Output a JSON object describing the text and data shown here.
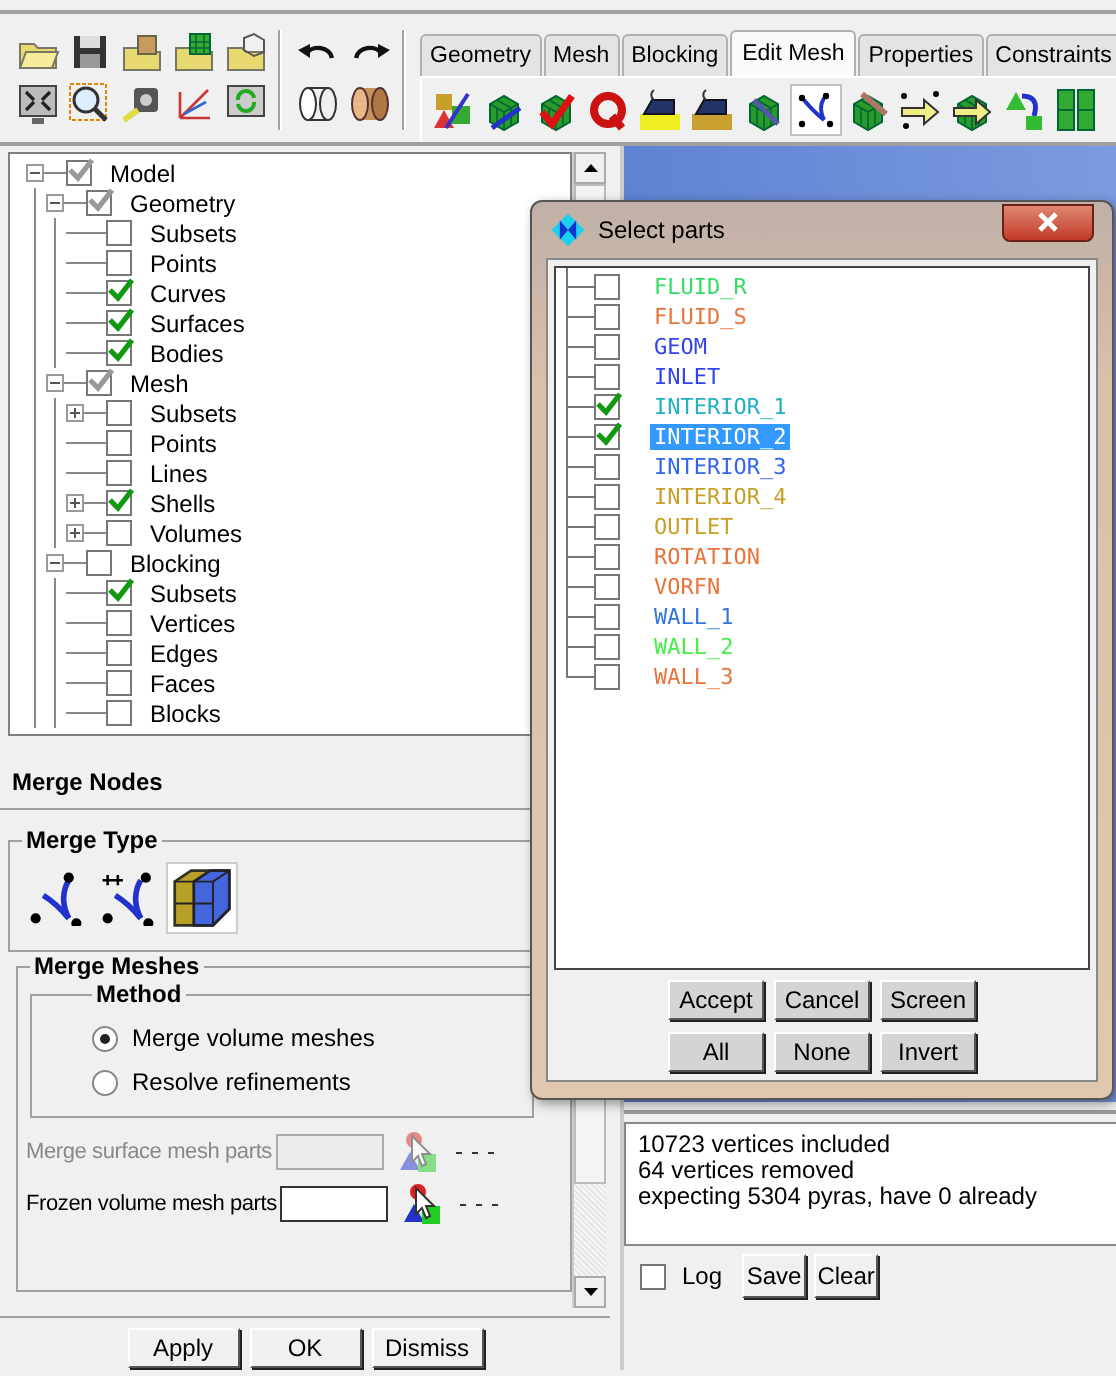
{
  "tabs": [
    {
      "label": "Geometry",
      "selected": false
    },
    {
      "label": "Mesh",
      "selected": false
    },
    {
      "label": "Blocking",
      "selected": false
    },
    {
      "label": "Edit Mesh",
      "selected": true
    },
    {
      "label": "Properties",
      "selected": false
    },
    {
      "label": "Constraints",
      "selected": false
    }
  ],
  "edit_mesh_tools": [
    {
      "selected": false
    },
    {
      "selected": false
    },
    {
      "selected": false
    },
    {
      "selected": false
    },
    {
      "selected": false
    },
    {
      "selected": false
    },
    {
      "selected": false
    },
    {
      "selected": true
    },
    {
      "selected": false
    },
    {
      "selected": false
    },
    {
      "selected": false
    },
    {
      "selected": false
    },
    {
      "selected": false
    }
  ],
  "tree": [
    {
      "label": "Model",
      "checked": true,
      "greyed": true,
      "expanded": true,
      "children": [
        {
          "label": "Geometry",
          "checked": true,
          "greyed": true,
          "expanded": true,
          "children": [
            {
              "label": "Subsets",
              "checked": false
            },
            {
              "label": "Points",
              "checked": false
            },
            {
              "label": "Curves",
              "checked": true
            },
            {
              "label": "Surfaces",
              "checked": true
            },
            {
              "label": "Bodies",
              "checked": true
            }
          ]
        },
        {
          "label": "Mesh",
          "checked": true,
          "greyed": true,
          "expanded": true,
          "children": [
            {
              "label": "Subsets",
              "checked": false,
              "expanded": false
            },
            {
              "label": "Points",
              "checked": false
            },
            {
              "label": "Lines",
              "checked": false
            },
            {
              "label": "Shells",
              "checked": true,
              "expanded": false
            },
            {
              "label": "Volumes",
              "checked": false,
              "expanded": false
            }
          ]
        },
        {
          "label": "Blocking",
          "checked": false,
          "expanded": true,
          "children": [
            {
              "label": "Subsets",
              "checked": true
            },
            {
              "label": "Vertices",
              "checked": false
            },
            {
              "label": "Edges",
              "checked": false
            },
            {
              "label": "Faces",
              "checked": false
            },
            {
              "label": "Blocks",
              "checked": false
            }
          ]
        }
      ]
    }
  ],
  "panel": {
    "title": "Merge Nodes",
    "merge_type": {
      "label": "Merge Type",
      "options": [
        {
          "selected": false
        },
        {
          "selected": false
        },
        {
          "selected": true
        }
      ]
    },
    "merge_meshes": {
      "label": "Merge Meshes",
      "method": {
        "label": "Method",
        "options": [
          {
            "label": "Merge volume meshes",
            "selected": true
          },
          {
            "label": "Resolve refinements",
            "selected": false
          }
        ]
      },
      "fields": [
        {
          "label": "Merge surface mesh parts",
          "disabled": true
        },
        {
          "label": "Frozen volume mesh parts",
          "disabled": false
        }
      ]
    }
  },
  "panel_buttons": [
    "Apply",
    "OK",
    "Dismiss"
  ],
  "dialog": {
    "title": "Select parts",
    "parts": [
      {
        "name": "FLUID_R",
        "color": "#33dd66",
        "checked": false,
        "selected": false
      },
      {
        "name": "FLUID_S",
        "color": "#e8743a",
        "checked": false,
        "selected": false
      },
      {
        "name": "GEOM",
        "color": "#3344ee",
        "checked": false,
        "selected": false
      },
      {
        "name": "INLET",
        "color": "#3344ee",
        "checked": false,
        "selected": false
      },
      {
        "name": "INTERIOR_1",
        "color": "#22b0c4",
        "checked": true,
        "selected": false
      },
      {
        "name": "INTERIOR_2",
        "checked": true,
        "selected": true
      },
      {
        "name": "INTERIOR_3",
        "color": "#3366ee",
        "checked": false,
        "selected": false
      },
      {
        "name": "INTERIOR_4",
        "color": "#c8a028",
        "checked": false,
        "selected": false
      },
      {
        "name": "OUTLET",
        "color": "#c8a028",
        "checked": false,
        "selected": false
      },
      {
        "name": "ROTATION",
        "color": "#e8743a",
        "checked": false,
        "selected": false
      },
      {
        "name": "VORFN",
        "color": "#e8743a",
        "checked": false,
        "selected": false
      },
      {
        "name": "WALL_1",
        "color": "#3377dd",
        "checked": false,
        "selected": false
      },
      {
        "name": "WALL_2",
        "color": "#44ee44",
        "checked": false,
        "selected": false
      },
      {
        "name": "WALL_3",
        "color": "#e8743a",
        "checked": false,
        "selected": false
      }
    ],
    "buttons": [
      [
        "Accept",
        "Cancel",
        "Screen"
      ],
      [
        "All",
        "None",
        "Invert"
      ]
    ]
  },
  "messages": [
    "10723 vertices included",
    "64 vertices removed",
    "expecting 5304 pyras, have 0 already"
  ],
  "log": {
    "label": "Log",
    "checked": false
  },
  "message_buttons": [
    "Save",
    "Clear"
  ]
}
